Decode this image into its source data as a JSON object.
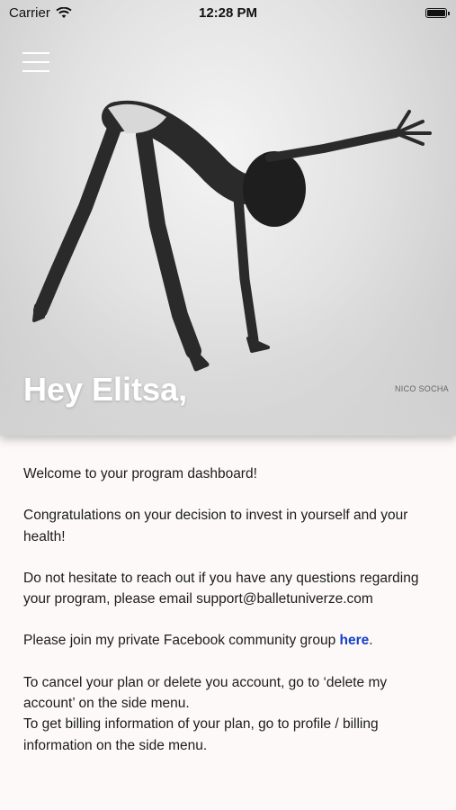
{
  "status_bar": {
    "carrier": "Carrier",
    "time": "12:28 PM"
  },
  "hero": {
    "greeting": "Hey Elitsa,",
    "photo_credit": "NICO SOCHA"
  },
  "content": {
    "welcome": "Welcome to your program dashboard!",
    "congrats": "Congratulations on your decision to invest in yourself and your health!",
    "reach_out": "Do not hesitate to reach out if you have any questions regarding your program, please email support@balletuniverze.com",
    "join_prefix": "Please join my private Facebook community group ",
    "join_link": "here",
    "join_suffix": ".",
    "cancel": "To cancel your plan or delete you account, go to ‘delete my account’ on the side menu.",
    "billing": "To get billing information of your plan, go to profile / billing information on the side menu."
  },
  "icons": [
    "menu-icon",
    "wifi-icon",
    "battery-icon"
  ],
  "colors": {
    "link": "#1340c9",
    "background": "#fdf9f9",
    "greeting": "#ffffff"
  }
}
